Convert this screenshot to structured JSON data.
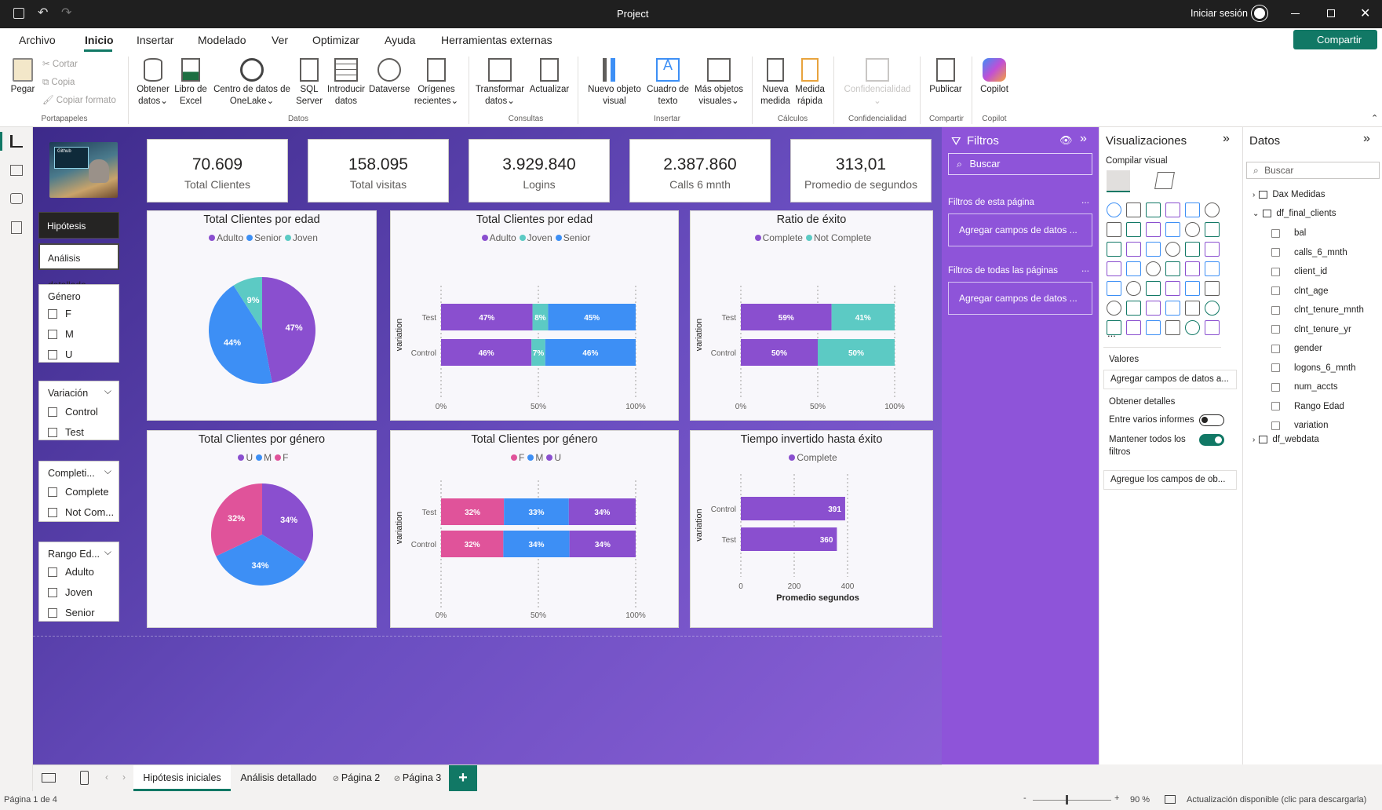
{
  "app": {
    "title": "Project",
    "sign_in": "Iniciar sesión",
    "share": "Compartir"
  },
  "menu": [
    "Archivo",
    "Inicio",
    "Insertar",
    "Modelado",
    "Ver",
    "Optimizar",
    "Ayuda",
    "Herramientas externas"
  ],
  "ribbon": {
    "paste": "Pegar",
    "cut": "Cortar",
    "copy": "Copia",
    "format_painter": "Copiar formato",
    "get_data": "Obtener datos",
    "excel": "Libro de Excel",
    "onelake": "Centro de datos de OneLake",
    "sql": "SQL Server",
    "enter_data": "Introducir datos",
    "dataverse": "Dataverse",
    "recent": "Orígenes recientes",
    "transform": "Transformar datos",
    "refresh": "Actualizar",
    "new_visual": "Nuevo objeto visual",
    "textbox": "Cuadro de texto",
    "more_visuals": "Más objetos visuales",
    "new_measure": "Nueva medida",
    "quick_measure": "Medida rápida",
    "sensitivity": "Confidencialidad",
    "publish": "Publicar",
    "copilot": "Copilot",
    "groups": {
      "clipboard": "Portapapeles",
      "data": "Datos",
      "queries": "Consultas",
      "insert": "Insertar",
      "calc": "Cálculos",
      "sensitivity": "Confidencialidad",
      "share": "Compartir",
      "copilot": "Copilot"
    }
  },
  "kpis": [
    {
      "value": "70.609",
      "label": "Total Clientes"
    },
    {
      "value": "158.095",
      "label": "Total visitas"
    },
    {
      "value": "3.929.840",
      "label": "Logins"
    },
    {
      "value": "2.387.860",
      "label": "Calls 6 mnth"
    },
    {
      "value": "313,01",
      "label": "Promedio de segundos"
    }
  ],
  "nav": {
    "btn1": "Hipótesis iniciales",
    "btn2": "Análisis detallado",
    "logo_caption": "Github"
  },
  "slicers": {
    "genero": {
      "title": "Género",
      "items": [
        "F",
        "M",
        "U"
      ]
    },
    "variacion": {
      "title": "Variación",
      "items": [
        "Control",
        "Test"
      ]
    },
    "completion": {
      "title": "Completi...",
      "items": [
        "Complete",
        "Not Com..."
      ]
    },
    "rango": {
      "title": "Rango Ed...",
      "items": [
        "Adulto",
        "Joven",
        "Senior"
      ]
    }
  },
  "colors": {
    "purple": "#8a4fcf",
    "blue": "#3d8ff5",
    "teal": "#5ccac4",
    "pink": "#e0539a"
  },
  "charts": {
    "pie_age": {
      "title": "Total Clientes por edad",
      "legend": [
        "Adulto",
        "Senior",
        "Joven"
      ]
    },
    "bar_age": {
      "title": "Total Clientes por edad",
      "legend": [
        "Adulto",
        "Joven",
        "Senior"
      ],
      "axis_title": "variation"
    },
    "bar_success": {
      "title": "Ratio de éxito",
      "legend": [
        "Complete",
        "Not Complete"
      ],
      "axis_title": "variation"
    },
    "pie_gender": {
      "title": "Total Clientes por género",
      "legend": [
        "U",
        "M",
        "F"
      ]
    },
    "bar_gender": {
      "title": "Total Clientes por género",
      "legend": [
        "F",
        "M",
        "U"
      ],
      "axis_title": "variation"
    },
    "bar_time": {
      "title": "Tiempo invertido hasta éxito",
      "legend": [
        "Complete"
      ],
      "axis_title": "variation",
      "xlabel": "Promedio segundos"
    }
  },
  "chart_data": [
    {
      "type": "pie",
      "title": "Total Clientes por edad",
      "labels": [
        "Adulto",
        "Senior",
        "Joven"
      ],
      "values": [
        47,
        44,
        9
      ]
    },
    {
      "type": "bar",
      "title": "Total Clientes por edad",
      "stacked_percent": true,
      "categories": [
        "Test",
        "Control"
      ],
      "series": [
        {
          "name": "Adulto",
          "values": [
            47,
            46
          ]
        },
        {
          "name": "Joven",
          "values": [
            8,
            7
          ]
        },
        {
          "name": "Senior",
          "values": [
            45,
            46
          ]
        }
      ],
      "xticks": [
        "0%",
        "50%",
        "100%"
      ],
      "ylabel": "variation"
    },
    {
      "type": "bar",
      "title": "Ratio de éxito",
      "stacked_percent": true,
      "categories": [
        "Test",
        "Control"
      ],
      "series": [
        {
          "name": "Complete",
          "values": [
            59,
            50
          ]
        },
        {
          "name": "Not Complete",
          "values": [
            41,
            50
          ]
        }
      ],
      "xticks": [
        "0%",
        "50%",
        "100%"
      ],
      "ylabel": "variation"
    },
    {
      "type": "pie",
      "title": "Total Clientes por género",
      "labels": [
        "U",
        "M",
        "F"
      ],
      "values": [
        34,
        34,
        32
      ]
    },
    {
      "type": "bar",
      "title": "Total Clientes por género",
      "stacked_percent": true,
      "categories": [
        "Test",
        "Control"
      ],
      "series": [
        {
          "name": "F",
          "values": [
            32,
            32
          ]
        },
        {
          "name": "M",
          "values": [
            33,
            34
          ]
        },
        {
          "name": "U",
          "values": [
            34,
            34
          ]
        }
      ],
      "xticks": [
        "0%",
        "50%",
        "100%"
      ],
      "ylabel": "variation"
    },
    {
      "type": "bar",
      "title": "Tiempo invertido hasta éxito",
      "categories": [
        "Control",
        "Test"
      ],
      "series": [
        {
          "name": "Complete",
          "values": [
            391,
            360
          ]
        }
      ],
      "xticks": [
        "0",
        "200",
        "400"
      ],
      "xlim": [
        0,
        400
      ],
      "xlabel": "Promedio segundos",
      "ylabel": "variation"
    }
  ],
  "filters": {
    "title": "Filtros",
    "search": "Buscar",
    "page_section": "Filtros de esta página",
    "all_section": "Filtros de todas las páginas",
    "add_fields": "Agregar campos de datos ...",
    "more": "..."
  },
  "viz": {
    "title": "Visualizaciones",
    "build": "Compilar visual",
    "values": "Valores",
    "add_values": "Agregar campos de datos a...",
    "drill": "Obtener detalles",
    "cross_report": "Entre varios informes",
    "keep_filters": "Mantener todos los filtros",
    "add_drill": "Agregue los campos de ob...",
    "more": "..."
  },
  "data": {
    "title": "Datos",
    "search": "Buscar",
    "tables": [
      "Dax Medidas",
      "df_final_clients",
      "df_webdata"
    ],
    "fields": [
      "bal",
      "calls_6_mnth",
      "client_id",
      "clnt_age",
      "clnt_tenure_mnth",
      "clnt_tenure_yr",
      "gender",
      "logons_6_mnth",
      "num_accts",
      "Rango Edad",
      "variation"
    ]
  },
  "tabs": [
    "Hipótesis iniciales",
    "Análisis detallado",
    "Página 2",
    "Página 3"
  ],
  "status": {
    "page": "Página 1 de 4",
    "zoom": "90 %",
    "update": "Actualización disponible (clic para descargarla)"
  }
}
